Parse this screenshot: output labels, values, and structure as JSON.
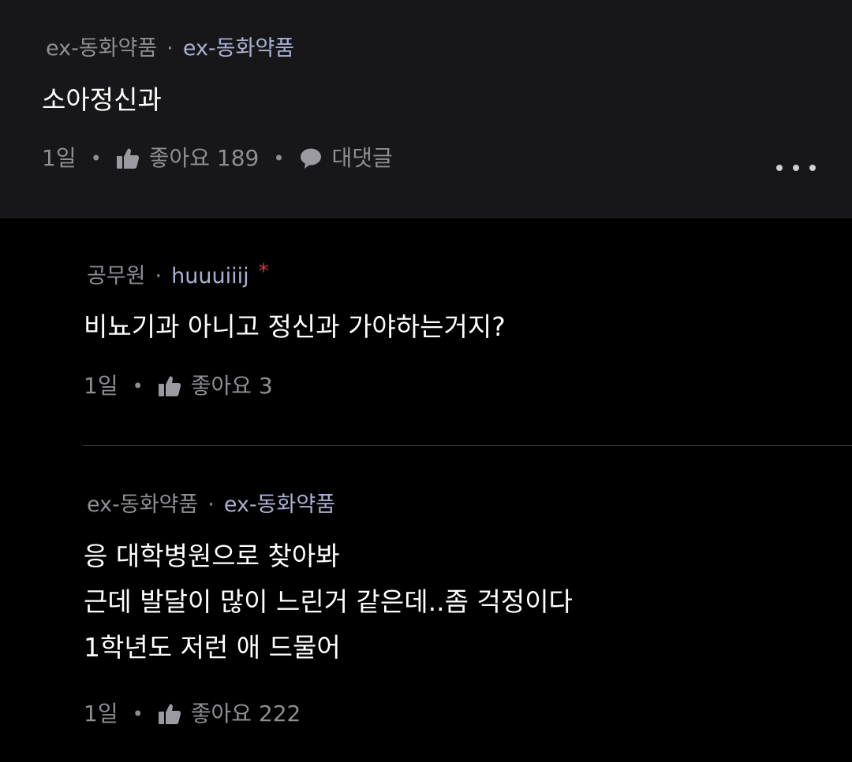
{
  "main_comment": {
    "author_group": "ex-동화약품",
    "author_nick": "ex-동화약품",
    "text": "소아정신과",
    "time": "1일",
    "likes_label": "좋아요 189",
    "reply_label": "대댓글"
  },
  "replies": [
    {
      "author_group": "공무원",
      "author_nick": "huuuiiij",
      "marker": "*",
      "lines": [
        "비뇨기과 아니고 정신과 가야하는거지?"
      ],
      "time": "1일",
      "likes_label": "좋아요 3"
    },
    {
      "author_group": "ex-동화약품",
      "author_nick": "ex-동화약품",
      "lines": [
        "응 대학병원으로 찾아봐",
        "근데 발달이 많이 느린거 같은데..좀 걱정이다",
        "1학년도 저런 애 드물어"
      ],
      "time": "1일",
      "likes_label": "좋아요 222"
    }
  ],
  "colors": {
    "background": "#000000",
    "main_comment_bg": "#17171a",
    "meta_gray": "#8e8e94",
    "nick_accent": "#aab0d2",
    "marker_red": "#d83a3a"
  },
  "icons": {
    "like": "thumbs-up-icon",
    "reply": "speech-bubble-icon",
    "more": "more-dots-icon"
  }
}
